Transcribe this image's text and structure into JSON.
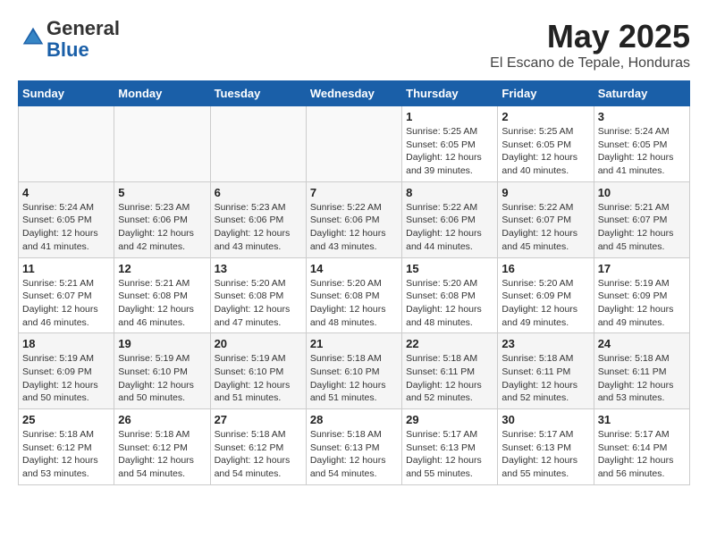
{
  "header": {
    "logo_general": "General",
    "logo_blue": "Blue",
    "month_year": "May 2025",
    "location": "El Escano de Tepale, Honduras"
  },
  "days_of_week": [
    "Sunday",
    "Monday",
    "Tuesday",
    "Wednesday",
    "Thursday",
    "Friday",
    "Saturday"
  ],
  "weeks": [
    [
      {
        "day": "",
        "info": ""
      },
      {
        "day": "",
        "info": ""
      },
      {
        "day": "",
        "info": ""
      },
      {
        "day": "",
        "info": ""
      },
      {
        "day": "1",
        "info": "Sunrise: 5:25 AM\nSunset: 6:05 PM\nDaylight: 12 hours\nand 39 minutes."
      },
      {
        "day": "2",
        "info": "Sunrise: 5:25 AM\nSunset: 6:05 PM\nDaylight: 12 hours\nand 40 minutes."
      },
      {
        "day": "3",
        "info": "Sunrise: 5:24 AM\nSunset: 6:05 PM\nDaylight: 12 hours\nand 41 minutes."
      }
    ],
    [
      {
        "day": "4",
        "info": "Sunrise: 5:24 AM\nSunset: 6:05 PM\nDaylight: 12 hours\nand 41 minutes."
      },
      {
        "day": "5",
        "info": "Sunrise: 5:23 AM\nSunset: 6:06 PM\nDaylight: 12 hours\nand 42 minutes."
      },
      {
        "day": "6",
        "info": "Sunrise: 5:23 AM\nSunset: 6:06 PM\nDaylight: 12 hours\nand 43 minutes."
      },
      {
        "day": "7",
        "info": "Sunrise: 5:22 AM\nSunset: 6:06 PM\nDaylight: 12 hours\nand 43 minutes."
      },
      {
        "day": "8",
        "info": "Sunrise: 5:22 AM\nSunset: 6:06 PM\nDaylight: 12 hours\nand 44 minutes."
      },
      {
        "day": "9",
        "info": "Sunrise: 5:22 AM\nSunset: 6:07 PM\nDaylight: 12 hours\nand 45 minutes."
      },
      {
        "day": "10",
        "info": "Sunrise: 5:21 AM\nSunset: 6:07 PM\nDaylight: 12 hours\nand 45 minutes."
      }
    ],
    [
      {
        "day": "11",
        "info": "Sunrise: 5:21 AM\nSunset: 6:07 PM\nDaylight: 12 hours\nand 46 minutes."
      },
      {
        "day": "12",
        "info": "Sunrise: 5:21 AM\nSunset: 6:08 PM\nDaylight: 12 hours\nand 46 minutes."
      },
      {
        "day": "13",
        "info": "Sunrise: 5:20 AM\nSunset: 6:08 PM\nDaylight: 12 hours\nand 47 minutes."
      },
      {
        "day": "14",
        "info": "Sunrise: 5:20 AM\nSunset: 6:08 PM\nDaylight: 12 hours\nand 48 minutes."
      },
      {
        "day": "15",
        "info": "Sunrise: 5:20 AM\nSunset: 6:08 PM\nDaylight: 12 hours\nand 48 minutes."
      },
      {
        "day": "16",
        "info": "Sunrise: 5:20 AM\nSunset: 6:09 PM\nDaylight: 12 hours\nand 49 minutes."
      },
      {
        "day": "17",
        "info": "Sunrise: 5:19 AM\nSunset: 6:09 PM\nDaylight: 12 hours\nand 49 minutes."
      }
    ],
    [
      {
        "day": "18",
        "info": "Sunrise: 5:19 AM\nSunset: 6:09 PM\nDaylight: 12 hours\nand 50 minutes."
      },
      {
        "day": "19",
        "info": "Sunrise: 5:19 AM\nSunset: 6:10 PM\nDaylight: 12 hours\nand 50 minutes."
      },
      {
        "day": "20",
        "info": "Sunrise: 5:19 AM\nSunset: 6:10 PM\nDaylight: 12 hours\nand 51 minutes."
      },
      {
        "day": "21",
        "info": "Sunrise: 5:18 AM\nSunset: 6:10 PM\nDaylight: 12 hours\nand 51 minutes."
      },
      {
        "day": "22",
        "info": "Sunrise: 5:18 AM\nSunset: 6:11 PM\nDaylight: 12 hours\nand 52 minutes."
      },
      {
        "day": "23",
        "info": "Sunrise: 5:18 AM\nSunset: 6:11 PM\nDaylight: 12 hours\nand 52 minutes."
      },
      {
        "day": "24",
        "info": "Sunrise: 5:18 AM\nSunset: 6:11 PM\nDaylight: 12 hours\nand 53 minutes."
      }
    ],
    [
      {
        "day": "25",
        "info": "Sunrise: 5:18 AM\nSunset: 6:12 PM\nDaylight: 12 hours\nand 53 minutes."
      },
      {
        "day": "26",
        "info": "Sunrise: 5:18 AM\nSunset: 6:12 PM\nDaylight: 12 hours\nand 54 minutes."
      },
      {
        "day": "27",
        "info": "Sunrise: 5:18 AM\nSunset: 6:12 PM\nDaylight: 12 hours\nand 54 minutes."
      },
      {
        "day": "28",
        "info": "Sunrise: 5:18 AM\nSunset: 6:13 PM\nDaylight: 12 hours\nand 54 minutes."
      },
      {
        "day": "29",
        "info": "Sunrise: 5:17 AM\nSunset: 6:13 PM\nDaylight: 12 hours\nand 55 minutes."
      },
      {
        "day": "30",
        "info": "Sunrise: 5:17 AM\nSunset: 6:13 PM\nDaylight: 12 hours\nand 55 minutes."
      },
      {
        "day": "31",
        "info": "Sunrise: 5:17 AM\nSunset: 6:14 PM\nDaylight: 12 hours\nand 56 minutes."
      }
    ]
  ]
}
